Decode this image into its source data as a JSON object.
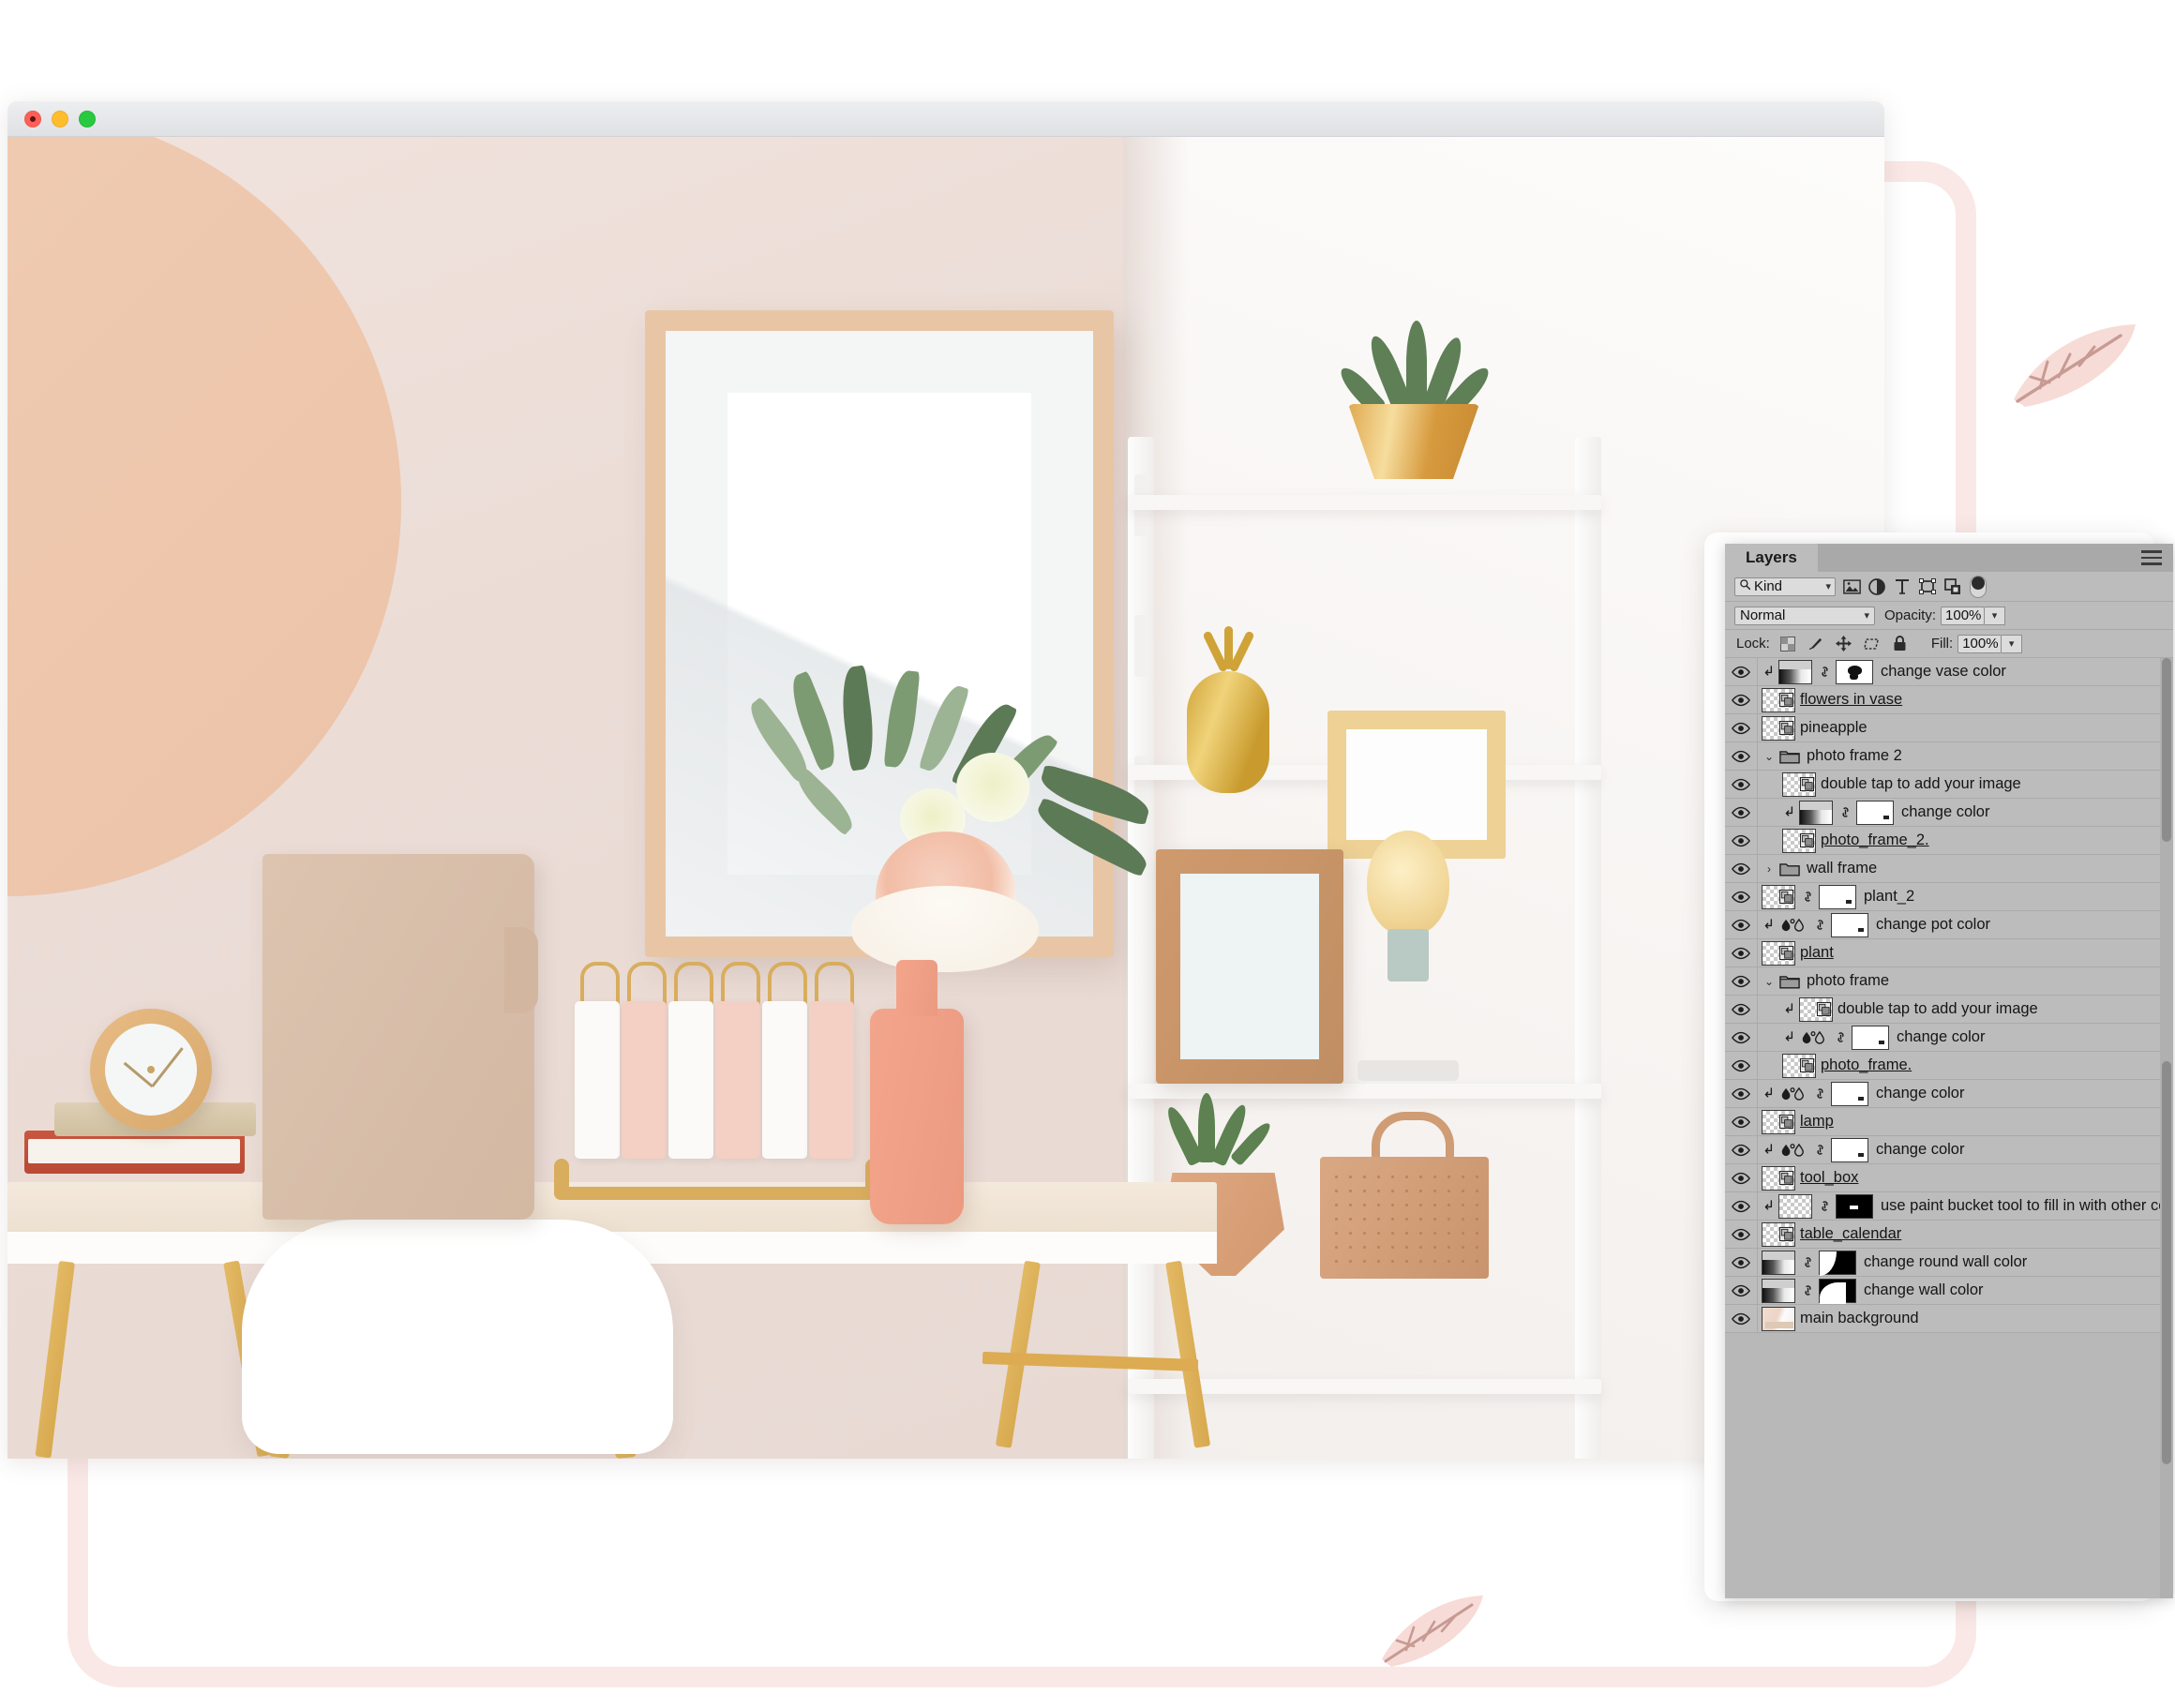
{
  "window": {
    "traffic_lights": [
      "close",
      "minimize",
      "maximize"
    ]
  },
  "panel": {
    "tab_label": "Layers",
    "menu_icon": "hamburger-menu-icon",
    "filter": {
      "kind_label": "Kind",
      "search_icon": "search-icon",
      "icons": [
        "image-filter-icon",
        "adjustment-filter-icon",
        "type-filter-icon",
        "shape-filter-icon",
        "smart-object-filter-icon"
      ],
      "toggle_icon": "filter-toggle-switch"
    },
    "blend": {
      "mode": "Normal",
      "opacity_label": "Opacity:",
      "opacity_value": "100%"
    },
    "lock": {
      "label": "Lock:",
      "icons": [
        "lock-transparent-pixels-icon",
        "lock-image-pixels-icon",
        "lock-position-icon",
        "lock-artboard-icon",
        "lock-all-icon"
      ],
      "fill_label": "Fill:",
      "fill_value": "100%"
    },
    "layers": [
      {
        "name": "change vase color",
        "indent": 0,
        "clipped": true,
        "type": "gradient-mask",
        "thumb": "grad",
        "mask": "vase-mask",
        "linked": true,
        "underline": false
      },
      {
        "name": "flowers in vase",
        "indent": 0,
        "clipped": false,
        "type": "smart-object",
        "thumb": "checker",
        "mask": null,
        "linked": false,
        "underline": true
      },
      {
        "name": "pineapple",
        "indent": 0,
        "clipped": false,
        "type": "smart-object",
        "thumb": "checker",
        "mask": null,
        "linked": false,
        "underline": false
      },
      {
        "name": "photo frame 2",
        "indent": 0,
        "clipped": false,
        "type": "group-open",
        "thumb": null,
        "mask": null,
        "linked": false,
        "underline": false
      },
      {
        "name": "double tap to add your image",
        "indent": 1,
        "clipped": false,
        "type": "smart-object",
        "thumb": "checker",
        "mask": null,
        "linked": false,
        "underline": false
      },
      {
        "name": "change color",
        "indent": 1,
        "clipped": true,
        "type": "gradient-mask",
        "thumb": "grad",
        "mask": "white-mask",
        "linked": true,
        "underline": false
      },
      {
        "name": "photo_frame_2.",
        "indent": 1,
        "clipped": false,
        "type": "smart-object",
        "thumb": "checker",
        "mask": null,
        "linked": false,
        "underline": true
      },
      {
        "name": "wall frame",
        "indent": 0,
        "clipped": false,
        "type": "group-closed",
        "thumb": null,
        "mask": null,
        "linked": false,
        "underline": false
      },
      {
        "name": "plant_2",
        "indent": 0,
        "clipped": false,
        "type": "smart-object",
        "thumb": "checker",
        "mask": "white-mask",
        "linked": true,
        "underline": false
      },
      {
        "name": "change pot color",
        "indent": 0,
        "clipped": true,
        "type": "hue-sat",
        "thumb": null,
        "mask": "white-mask",
        "linked": true,
        "underline": false
      },
      {
        "name": "plant",
        "indent": 0,
        "clipped": false,
        "type": "smart-object",
        "thumb": "checker",
        "mask": null,
        "linked": false,
        "underline": true
      },
      {
        "name": "photo frame",
        "indent": 0,
        "clipped": false,
        "type": "group-open",
        "thumb": null,
        "mask": null,
        "linked": false,
        "underline": false
      },
      {
        "name": "double tap to add your image",
        "indent": 1,
        "clipped": true,
        "type": "smart-object",
        "thumb": "checker",
        "mask": null,
        "linked": false,
        "underline": false
      },
      {
        "name": "change color",
        "indent": 1,
        "clipped": true,
        "type": "hue-sat",
        "thumb": null,
        "mask": "white-mask",
        "linked": true,
        "underline": false
      },
      {
        "name": "photo_frame.",
        "indent": 1,
        "clipped": false,
        "type": "smart-object",
        "thumb": "checker",
        "mask": null,
        "linked": false,
        "underline": true
      },
      {
        "name": "change color",
        "indent": 0,
        "clipped": true,
        "type": "hue-sat",
        "thumb": null,
        "mask": "white-mask",
        "linked": true,
        "underline": false
      },
      {
        "name": "lamp",
        "indent": 0,
        "clipped": false,
        "type": "smart-object",
        "thumb": "checker",
        "mask": null,
        "linked": false,
        "underline": true
      },
      {
        "name": "change color",
        "indent": 0,
        "clipped": true,
        "type": "hue-sat",
        "thumb": null,
        "mask": "white-mask",
        "linked": true,
        "underline": false
      },
      {
        "name": "tool_box",
        "indent": 0,
        "clipped": false,
        "type": "smart-object",
        "thumb": "checker",
        "mask": null,
        "linked": false,
        "underline": true
      },
      {
        "name": "use paint bucket tool to fill in with other color",
        "indent": 0,
        "clipped": true,
        "type": "pixel",
        "thumb": "checker",
        "mask": "black-mask",
        "linked": true,
        "underline": false
      },
      {
        "name": "table_calendar",
        "indent": 0,
        "clipped": false,
        "type": "smart-object",
        "thumb": "checker",
        "mask": null,
        "linked": false,
        "underline": true
      },
      {
        "name": "change round wall color",
        "indent": 0,
        "clipped": false,
        "type": "gradient-mask",
        "thumb": "grad",
        "mask": "black-mask-round",
        "linked": true,
        "underline": false
      },
      {
        "name": "change wall color",
        "indent": 0,
        "clipped": false,
        "type": "gradient-mask",
        "thumb": "grad",
        "mask": "black-mask-wall",
        "linked": true,
        "underline": false
      },
      {
        "name": "main background",
        "indent": 0,
        "clipped": false,
        "type": "pixel",
        "thumb": "photo",
        "mask": null,
        "linked": false,
        "underline": false
      }
    ]
  },
  "colors": {
    "panel_bg": "#bcbcbc",
    "panel_tabbar": "#a9a9a9",
    "accent_pink": "#fae8e6",
    "wall_left": "#ebdcd6",
    "round_wall": "#ecc3a8",
    "vase_pink": "#eb9a80",
    "gold": "#d9ad5e"
  }
}
